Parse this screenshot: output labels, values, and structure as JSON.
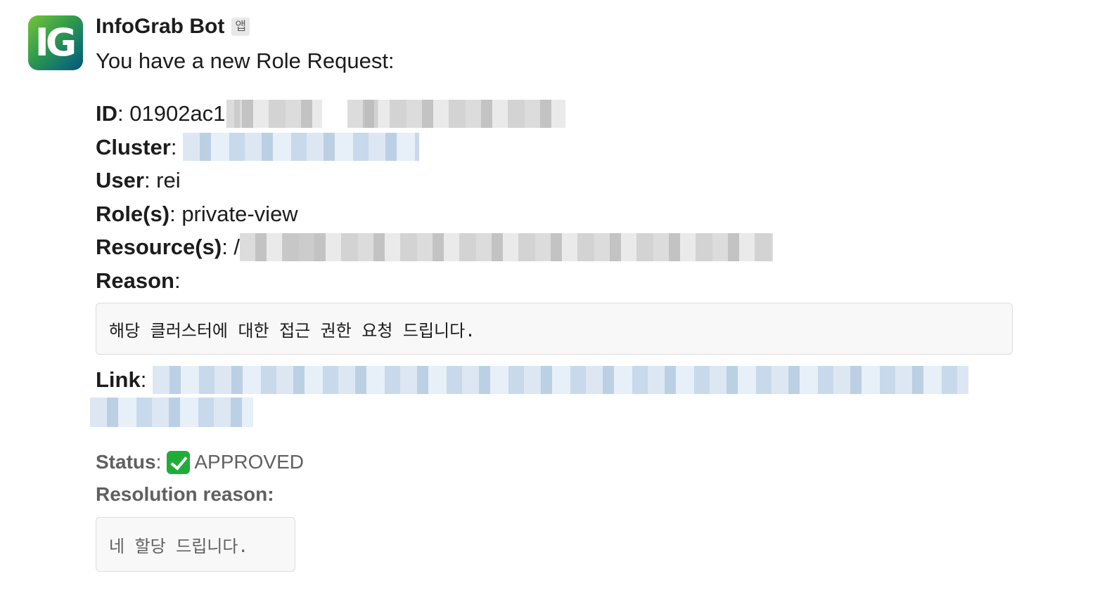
{
  "bot": {
    "avatar_text": "IG",
    "name": "InfoGrab Bot",
    "badge": "앱"
  },
  "message": {
    "intro": "You have a new Role Request:",
    "fields": {
      "id_label": "ID",
      "id_value": "01902ac1",
      "cluster_label": "Cluster",
      "user_label": "User",
      "user_value": "rei",
      "roles_label": "Role(s)",
      "roles_value": "private-view",
      "resources_label": "Resource(s)",
      "resources_value": "/",
      "reason_label": "Reason",
      "link_label": "Link"
    },
    "reason_text": "해당 클러스터에 대한 접근 권한 요청 드립니다.",
    "status_label": "Status",
    "status_value": "APPROVED",
    "resolution_label": "Resolution reason",
    "resolution_text": "네 할당 드립니다."
  },
  "colors": {
    "text": "#1d1c1d",
    "muted": "#616061",
    "check": "#1fad3a"
  }
}
